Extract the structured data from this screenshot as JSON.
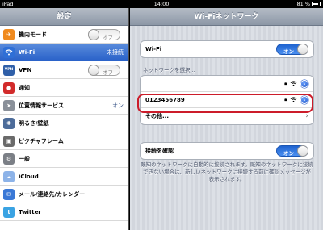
{
  "status_bar": {
    "device": "iPad",
    "time": "14:00",
    "battery": "81 %"
  },
  "sidebar": {
    "title": "設定",
    "items": [
      {
        "label": "機内モード",
        "icon": "airplane-icon",
        "icon_color": "#f08a1e",
        "glyph": "✈",
        "toggle": "オフ"
      },
      {
        "label": "Wi-Fi",
        "icon": "wifi-icon",
        "icon_color": "#2f6fd6",
        "glyph": "≋",
        "value": "未接続",
        "selected": true
      },
      {
        "label": "VPN",
        "icon": "vpn-icon",
        "icon_color": "#2f5fa8",
        "glyph": "VPN",
        "toggle": "オフ"
      },
      {
        "label": "通知",
        "icon": "notification-icon",
        "icon_color": "#d22b2b",
        "glyph": "●"
      },
      {
        "label": "位置情報サービス",
        "icon": "location-icon",
        "icon_color": "#8a9099",
        "glyph": "➤",
        "value": "オン"
      },
      {
        "label": "明るさ/壁紙",
        "icon": "brightness-icon",
        "icon_color": "#4d6c9a",
        "glyph": "✺"
      },
      {
        "label": "ピクチャフレーム",
        "icon": "picture-frame-icon",
        "icon_color": "#6a6a6a",
        "glyph": "▣"
      },
      {
        "label": "一般",
        "icon": "gear-icon",
        "icon_color": "#7b7f86",
        "glyph": "⚙"
      },
      {
        "label": "iCloud",
        "icon": "cloud-icon",
        "icon_color": "#8db3e8",
        "glyph": "☁"
      },
      {
        "label": "メール/連絡先/カレンダー",
        "icon": "mail-icon",
        "icon_color": "#3a78d6",
        "glyph": "✉"
      },
      {
        "label": "Twitter",
        "icon": "twitter-icon",
        "icon_color": "#3aa3e3",
        "glyph": "t"
      }
    ]
  },
  "detail": {
    "title": "Wi-Fiネットワーク",
    "wifi_label": "Wi-Fi",
    "wifi_toggle": "オン",
    "choose_network_label": "ネットワークを選択...",
    "networks": [
      {
        "name": "",
        "locked": true
      },
      {
        "name": "0123456789",
        "locked": true
      },
      {
        "name": "その他..."
      }
    ],
    "ask_join_label": "接続を確認",
    "ask_join_toggle": "オン",
    "ask_join_note": "既知のネットワークに自動的に接続されます。既知のネットワークに接続できない場合は、新しいネットワークに接続する前に確認メッセージが表示されます。"
  },
  "colors": {
    "accent": "#2a62c9",
    "highlight": "#cc1c2a"
  }
}
